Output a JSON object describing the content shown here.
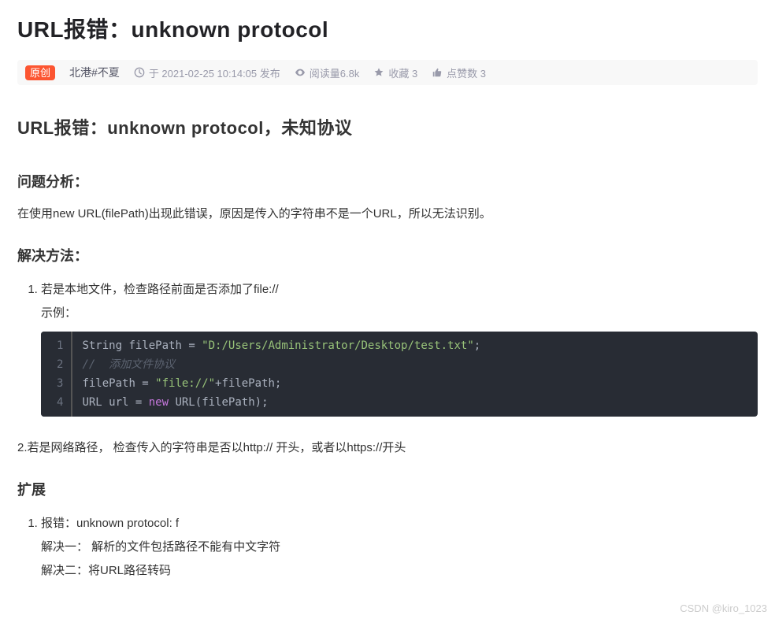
{
  "title": "URL报错：unknown protocol",
  "meta": {
    "original_badge": "原创",
    "author": "北港#不夏",
    "publish": "于 2021-02-25 10:14:05 发布",
    "views": "阅读量6.8k",
    "favorites": "收藏 3",
    "likes": "点赞数 3"
  },
  "subtitle": "URL报错：unknown protocol，未知协议",
  "sections": {
    "analysis_heading": "问题分析：",
    "analysis_body": "在使用new URL(filePath)出现此错误，原因是传入的字符串不是一个URL，所以无法识别。",
    "solution_heading": "解决方法：",
    "solution_li1_line1": "若是本地文件，检查路径前面是否添加了file://",
    "solution_li1_line2": "示例：",
    "solution_li2": "2.若是网络路径， 检查传入的字符串是否以http:// 开头，或者以https://开头",
    "extend_heading": "扩展",
    "extend_li1": "报错：unknown protocol: f",
    "extend_sol1": "解决一： 解析的文件包括路径不能有中文字符",
    "extend_sol2": "解决二：将URL路径转码"
  },
  "code": {
    "line1": {
      "a": "String ",
      "b": "filePath ",
      "c": "= ",
      "d": "\"D:/Users/Administrator/Desktop/test.txt\"",
      "e": ";"
    },
    "line2": {
      "a": "//  添加文件协议"
    },
    "line3": {
      "a": "filePath ",
      "b": "= ",
      "c": "\"file://\"",
      "d": "+",
      "e": "filePath",
      "f": ";"
    },
    "line4": {
      "a": "URL ",
      "b": "url ",
      "c": "= ",
      "d": "new ",
      "e": "URL",
      "f": "(",
      "g": "filePath",
      "h": ")",
      "i": ";"
    }
  },
  "watermark": "CSDN @kiro_1023"
}
